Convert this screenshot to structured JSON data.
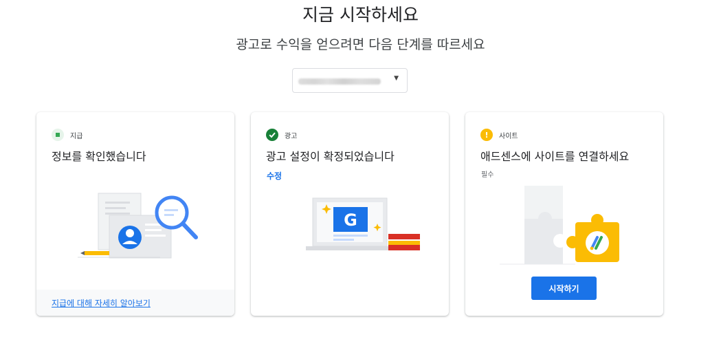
{
  "header": {
    "title": "지금 시작하세요",
    "subtitle": "광고로 수익을 얻으려면 다음 단계를 따르세요"
  },
  "account_selector": {
    "value": "",
    "caret": "▼"
  },
  "cards": [
    {
      "tag": "지급",
      "status": "pending",
      "status_color": "#34a853",
      "title": "정보를 확인했습니다",
      "footer_link": "지급에 대해 자세히 알아보기",
      "illustration": "document-magnifier"
    },
    {
      "tag": "광고",
      "status": "complete",
      "status_color": "#188038",
      "title": "광고 설정이 확정되었습니다",
      "edit_link": "수정",
      "illustration": "laptop-google-books"
    },
    {
      "tag": "사이트",
      "status": "warning",
      "status_color": "#fbbc04",
      "title": "애드센스에 사이트를 연결하세요",
      "required_label": "필수",
      "button": "시작하기",
      "illustration": "puzzle-adsense"
    }
  ],
  "colors": {
    "accent": "#1a73e8",
    "success": "#188038",
    "warning": "#fbbc04"
  }
}
